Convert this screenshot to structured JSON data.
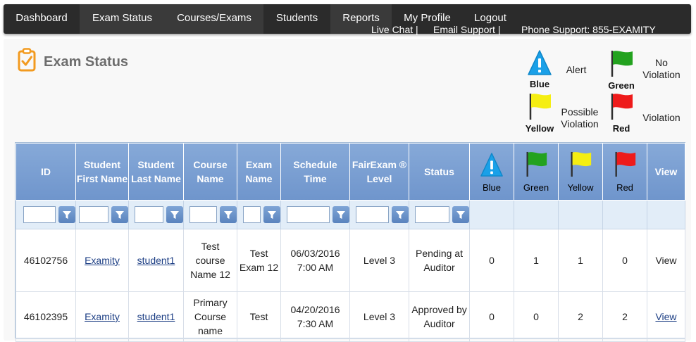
{
  "nav": {
    "items": [
      {
        "label": "Dashboard"
      },
      {
        "label": "Exam Status"
      },
      {
        "label": "Courses/Exams"
      },
      {
        "label": "Students"
      },
      {
        "label": "Reports"
      },
      {
        "label": "My Profile"
      },
      {
        "label": "Logout"
      }
    ],
    "support": {
      "live_chat": "Live Chat |",
      "email_support": "Email Support |",
      "phone_support": "Phone Support: 855-EXAMITY"
    }
  },
  "page": {
    "title": "Exam Status",
    "icon": "clipboard-check-icon"
  },
  "legend": [
    {
      "color_name": "Blue",
      "color": "#1aa0e8",
      "icon": "alert-triangle-icon",
      "desc": "Alert"
    },
    {
      "color_name": "Green",
      "color": "#23a21f",
      "icon": "flag-icon",
      "desc": "No Violation"
    },
    {
      "color_name": "Yellow",
      "color": "#f5ee12",
      "icon": "flag-icon",
      "desc": "Possible Violation"
    },
    {
      "color_name": "Red",
      "color": "#ee1b1b",
      "icon": "flag-icon",
      "desc": "Violation"
    }
  ],
  "table": {
    "columns": {
      "id": "ID",
      "first_name": "Student First Name",
      "last_name": "Student Last Name",
      "course": "Course Name",
      "exam": "Exam Name",
      "schedule": "Schedule Time",
      "fairexam": "FairExam ® Level",
      "status": "Status",
      "blue": "Blue",
      "green": "Green",
      "yellow": "Yellow",
      "red": "Red",
      "view": "View"
    },
    "filters": {
      "id": "",
      "first_name": "",
      "last_name": "",
      "course": "",
      "exam": "",
      "schedule": "",
      "fairexam": "",
      "status": ""
    },
    "rows": [
      {
        "id": "46102756",
        "first_name": "Examity",
        "last_name": "student1",
        "course": "Test course Name 12",
        "exam": "Test Exam 12",
        "schedule": "06/03/2016 7:00 AM",
        "fairexam": "Level 3",
        "status": "Pending at Auditor",
        "blue": "0",
        "green": "1",
        "yellow": "1",
        "red": "0",
        "view": "View"
      },
      {
        "id": "46102395",
        "first_name": "Examity",
        "last_name": "student1",
        "course": "Primary Course name",
        "exam": "Test",
        "schedule": "04/20/2016 7:30 AM",
        "fairexam": "Level 3",
        "status": "Approved by Auditor",
        "blue": "0",
        "green": "0",
        "yellow": "2",
        "red": "2",
        "view": "View"
      }
    ]
  },
  "colors": {
    "nav_bg": "#2b2b2b",
    "header_blue": "#7a9fd3",
    "filter_row_bg": "#e2edf8",
    "link": "#1c3e84",
    "title_gray": "#6d6d6d",
    "icon_orange": "#f29a1f"
  }
}
